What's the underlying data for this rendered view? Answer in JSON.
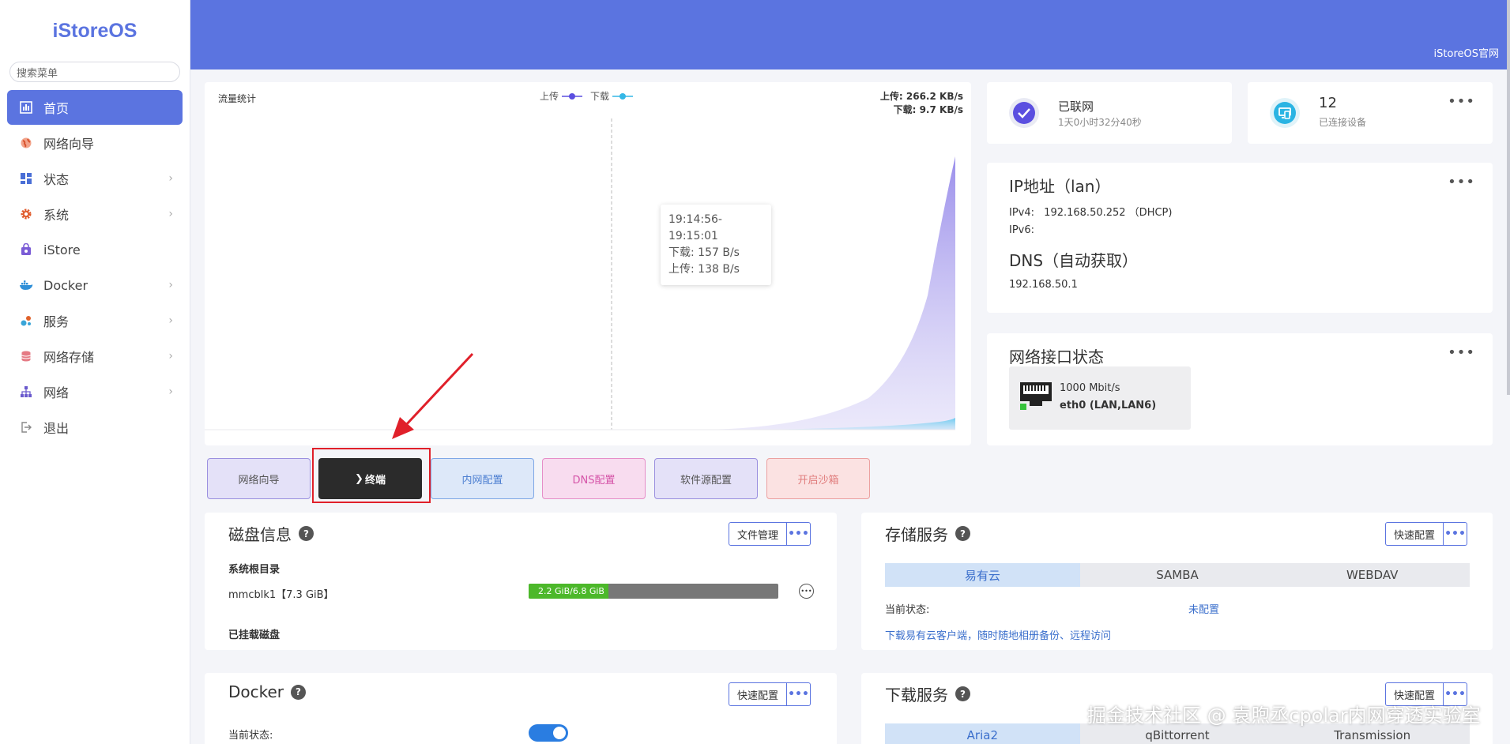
{
  "app": {
    "logo": "iStoreOS",
    "header_link": "iStoreOS官网"
  },
  "sidebar": {
    "search_placeholder": "搜索菜单",
    "items": [
      {
        "label": "首页",
        "icon": "dashboard-icon",
        "active": true
      },
      {
        "label": "网络向导",
        "icon": "globe-icon"
      },
      {
        "label": "状态",
        "icon": "grid-icon"
      },
      {
        "label": "系统",
        "icon": "gear-icon"
      },
      {
        "label": "iStore",
        "icon": "bag-icon"
      },
      {
        "label": "Docker",
        "icon": "docker-icon"
      },
      {
        "label": "服务",
        "icon": "puzzle-icon"
      },
      {
        "label": "网络存储",
        "icon": "database-icon"
      },
      {
        "label": "网络",
        "icon": "network-icon"
      },
      {
        "label": "退出",
        "icon": "logout-icon"
      }
    ]
  },
  "traffic": {
    "title": "流量统计",
    "legend_upload": "上传",
    "legend_download": "下载",
    "upload_rate": "上传: 266.2 KB/s",
    "download_rate": "下载: 9.7 KB/s",
    "tooltip_time": "19:14:56-19:15:01",
    "tooltip_download": "下载: 157 B/s",
    "tooltip_upload": "上传: 138 B/s",
    "colors": {
      "upload": "#5b4fe0",
      "download": "#35b7e6"
    }
  },
  "quick_buttons": [
    "网络向导",
    "终端",
    "内网配置",
    "DNS配置",
    "软件源配置",
    "开启沙箱"
  ],
  "status": {
    "online_title": "已联网",
    "online_sub": "1天0小时32分40秒",
    "devices_count": "12",
    "devices_label": "已连接设备"
  },
  "ip": {
    "title": "IP地址（lan）",
    "ipv4_label": "IPv4:",
    "ipv4_value": "192.168.50.252 （DHCP)",
    "ipv6_label": "IPv6:",
    "dns_title": "DNS（自动获取）",
    "dns_value": "192.168.50.1"
  },
  "interface": {
    "title": "网络接口状态",
    "speed": "1000 Mbit/s",
    "name": "eth0 (LAN,LAN6)"
  },
  "disk": {
    "title": "磁盘信息",
    "btn": "文件管理",
    "root_label": "系统根目录",
    "device": "mmcblk1【7.3 GiB】",
    "usage_text": "2.2 GiB/6.8 GiB",
    "usage_fraction": 0.32,
    "mounted_label": "已挂载磁盘"
  },
  "storage": {
    "title": "存储服务",
    "btn": "快速配置",
    "tabs": [
      "易有云",
      "SAMBA",
      "WEBDAV"
    ],
    "status_label": "当前状态:",
    "status_value": "未配置",
    "download_link": "下载易有云客户端，随时随地相册备份、远程访问"
  },
  "docker": {
    "title": "Docker",
    "btn": "快速配置",
    "status_label": "当前状态:",
    "toggle_on": true
  },
  "download": {
    "title": "下载服务",
    "btn": "快速配置",
    "tabs": [
      "Aria2",
      "qBittorrent",
      "Transmission"
    ]
  },
  "watermark": "掘金技术社区 @ 袁煦丞cpolar内网穿透实验室"
}
